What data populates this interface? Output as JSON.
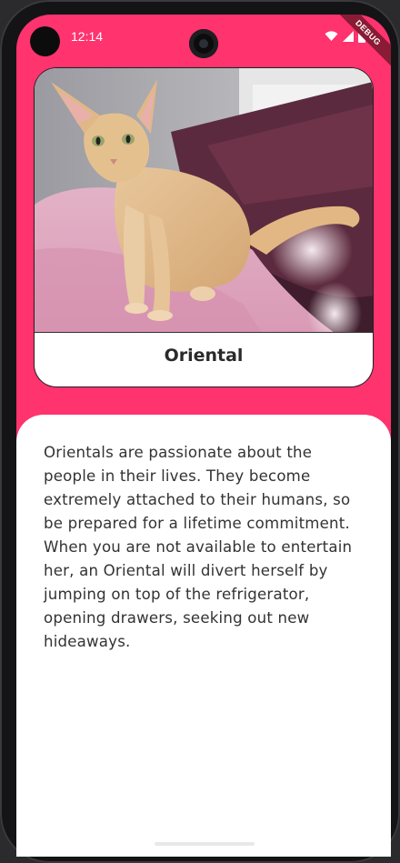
{
  "status_bar": {
    "time": "12:14",
    "debug_label": "DEBUG",
    "icons": [
      "wifi-icon",
      "signal-icon",
      "battery-icon"
    ]
  },
  "card": {
    "image": "oriental-cat-photo",
    "title": "Oriental"
  },
  "description": "Orientals are passionate about the people in their lives. They become extremely attached to their humans, so be prepared for a lifetime commitment. When you are not available to entertain her, an Oriental will divert herself by jumping on top of the refrigerator, opening drawers, seeking out new hideaways.",
  "colors": {
    "accent": "#ff336e",
    "panel": "#ffffff",
    "text": "#333333"
  }
}
